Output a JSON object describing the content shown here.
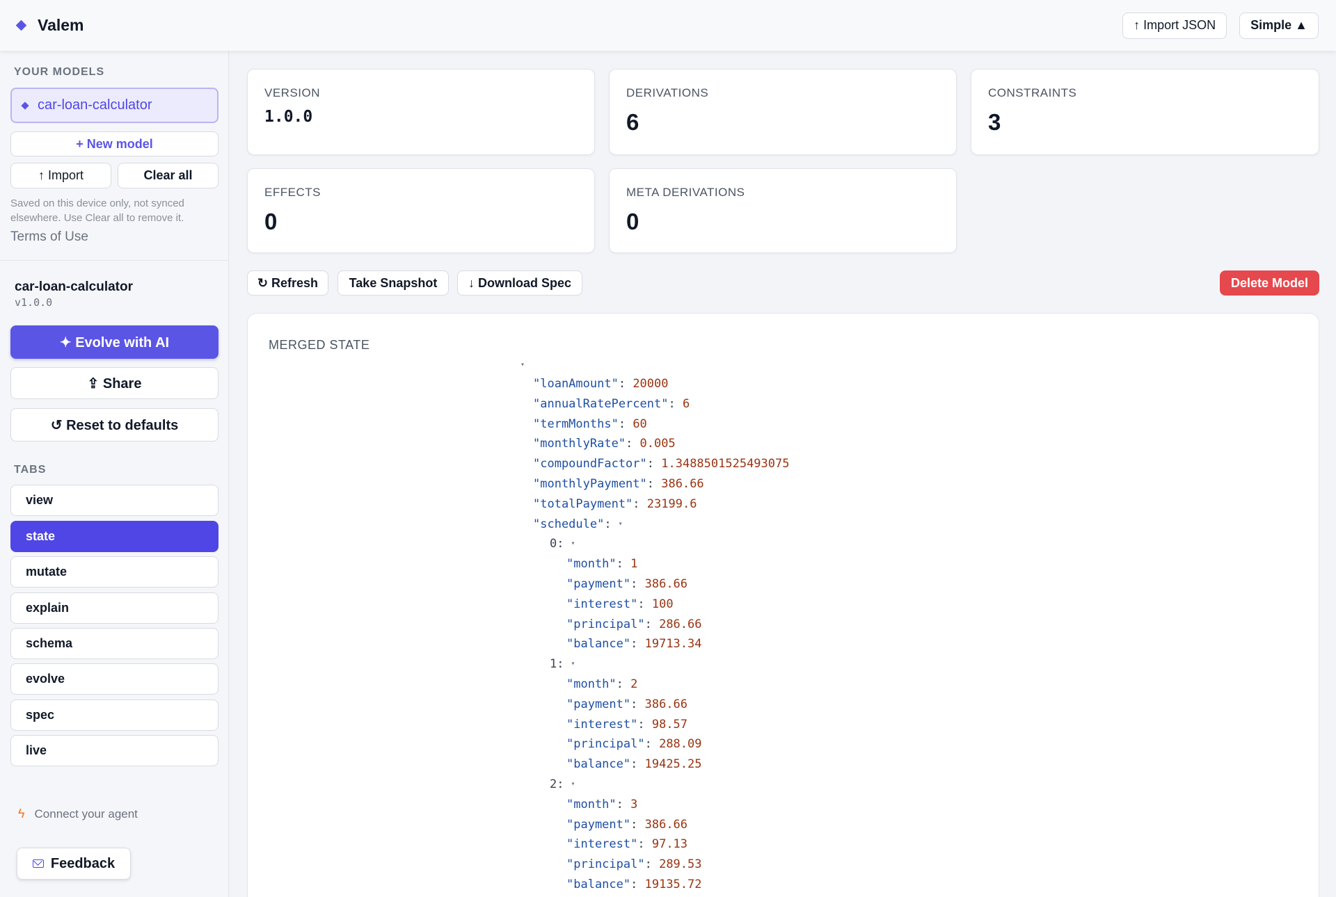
{
  "header": {
    "title": "Valem",
    "import_json_label": "↑ Import JSON",
    "mode_label": "Simple ▲"
  },
  "sidebar": {
    "your_models_label": "YOUR MODELS",
    "models": [
      {
        "name": "car-loan-calculator"
      }
    ],
    "new_model_label": "+ New model",
    "import_label": "↑ Import",
    "clear_all_label": "Clear all",
    "saved_note": "Saved on this device only, not synced elsewhere. Use Clear all to remove it.",
    "terms_label": "Terms of Use",
    "current_model": {
      "name": "car-loan-calculator",
      "version": "v1.0.0"
    },
    "evolve_label": "✦ Evolve with AI",
    "share_label": "⇪ Share",
    "reset_label": "↺ Reset to defaults",
    "tabs_label": "TABS",
    "tabs": [
      "view",
      "state",
      "mutate",
      "explain",
      "schema",
      "evolve",
      "spec",
      "live"
    ],
    "active_tab": "state",
    "connect_label": "Connect your agent",
    "feedback_label": "Feedback"
  },
  "stats": {
    "version": {
      "label": "VERSION",
      "value": "1.0.0"
    },
    "derivations": {
      "label": "DERIVATIONS",
      "value": "6"
    },
    "constraints": {
      "label": "CONSTRAINTS",
      "value": "3"
    },
    "effects": {
      "label": "EFFECTS",
      "value": "0"
    },
    "meta_derivations": {
      "label": "META DERIVATIONS",
      "value": "0"
    }
  },
  "actions": {
    "refresh_label": "↻ Refresh",
    "snapshot_label": "Take Snapshot",
    "download_label": "↓ Download Spec",
    "delete_label": "Delete Model"
  },
  "merged_state": {
    "title": "MERGED STATE",
    "fields": [
      {
        "key": "\"loanAmount\"",
        "value": "20000"
      },
      {
        "key": "\"annualRatePercent\"",
        "value": "6"
      },
      {
        "key": "\"termMonths\"",
        "value": "60"
      },
      {
        "key": "\"monthlyRate\"",
        "value": "0.005"
      },
      {
        "key": "\"compoundFactor\"",
        "value": "1.3488501525493075"
      },
      {
        "key": "\"monthlyPayment\"",
        "value": "386.66"
      },
      {
        "key": "\"totalPayment\"",
        "value": "23199.6"
      }
    ],
    "schedule_key": "\"schedule\"",
    "schedule": [
      {
        "index": "0",
        "entries": [
          {
            "key": "\"month\"",
            "value": "1"
          },
          {
            "key": "\"payment\"",
            "value": "386.66"
          },
          {
            "key": "\"interest\"",
            "value": "100"
          },
          {
            "key": "\"principal\"",
            "value": "286.66"
          },
          {
            "key": "\"balance\"",
            "value": "19713.34"
          }
        ]
      },
      {
        "index": "1",
        "entries": [
          {
            "key": "\"month\"",
            "value": "2"
          },
          {
            "key": "\"payment\"",
            "value": "386.66"
          },
          {
            "key": "\"interest\"",
            "value": "98.57"
          },
          {
            "key": "\"principal\"",
            "value": "288.09"
          },
          {
            "key": "\"balance\"",
            "value": "19425.25"
          }
        ]
      },
      {
        "index": "2",
        "entries": [
          {
            "key": "\"month\"",
            "value": "3"
          },
          {
            "key": "\"payment\"",
            "value": "386.66"
          },
          {
            "key": "\"interest\"",
            "value": "97.13"
          },
          {
            "key": "\"principal\"",
            "value": "289.53"
          },
          {
            "key": "\"balance\"",
            "value": "19135.72"
          }
        ]
      }
    ]
  },
  "colors": {
    "accent": "#5b55e6",
    "danger": "#e5484d",
    "json_key": "#1e4fa3",
    "json_number": "#9a3412"
  }
}
